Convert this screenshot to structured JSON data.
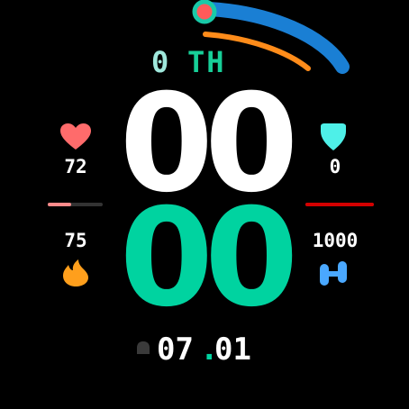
{
  "face": {
    "day_number": "0",
    "day_suffix": "TH",
    "hours": "00",
    "minutes": "00",
    "date": {
      "month": "07",
      "separator": ".",
      "day": "01"
    }
  },
  "metrics": {
    "heart_rate": {
      "value": "72",
      "icon": "heart-icon",
      "color": "#ff6b6b",
      "progress": 0.42
    },
    "spo2": {
      "value": "0",
      "icon": "shield-icon",
      "color": "#4ef0e8",
      "progress": 1.0
    },
    "calories": {
      "value": "75",
      "icon": "flame-icon",
      "color": "#ff9f1c"
    },
    "steps": {
      "value": "1000",
      "icon": "footprint-icon",
      "color": "#4aa8ff"
    }
  },
  "arcs": {
    "outer_color": "#1a7fd4",
    "inner_color": "#ff8c1a",
    "indicator_color": "#ff5a5a",
    "indicator_ring": "#19c9a8"
  },
  "colors": {
    "hr_bar": "#ff8a8a",
    "spo_bar": "#d40000",
    "accent": "#00d3a0"
  }
}
